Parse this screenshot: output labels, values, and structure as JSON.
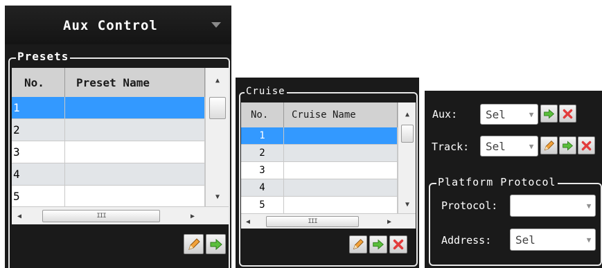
{
  "aux_control": {
    "title": "Aux Control",
    "collapse_icon": "triangle-down-icon",
    "presets": {
      "legend": "Presets",
      "columns": [
        "No.",
        "Preset Name"
      ],
      "rows": [
        {
          "no": "1",
          "name": "",
          "selected": true
        },
        {
          "no": "2",
          "name": "",
          "selected": false
        },
        {
          "no": "3",
          "name": "",
          "selected": false
        },
        {
          "no": "4",
          "name": "",
          "selected": false
        },
        {
          "no": "5",
          "name": "",
          "selected": false
        }
      ],
      "hscroll_grip": "III",
      "buttons": [
        "pencil-icon",
        "arrow-right-icon"
      ]
    }
  },
  "cruise": {
    "legend": "Cruise",
    "columns": [
      "No.",
      "Cruise Name"
    ],
    "rows": [
      {
        "no": "1",
        "name": "",
        "selected": true
      },
      {
        "no": "2",
        "name": "",
        "selected": false
      },
      {
        "no": "3",
        "name": "",
        "selected": false
      },
      {
        "no": "4",
        "name": "",
        "selected": false
      },
      {
        "no": "5",
        "name": "",
        "selected": false
      }
    ],
    "hscroll_grip": "III",
    "buttons": [
      "pencil-icon",
      "arrow-right-icon",
      "delete-x-icon"
    ]
  },
  "aux_track": {
    "aux_label": "Aux:",
    "aux_value": "Sel",
    "track_label": "Track:",
    "track_value": "Sel"
  },
  "platform_protocol": {
    "legend": "Platform Protocol",
    "protocol_label": "Protocol:",
    "protocol_value": "",
    "address_label": "Address:",
    "address_value": "Sel"
  },
  "colors": {
    "panel_bg": "#1a1a1a",
    "selection": "#3399ff",
    "alt_row": "#e2e5e8",
    "header_bg": "#d2d2d2"
  }
}
